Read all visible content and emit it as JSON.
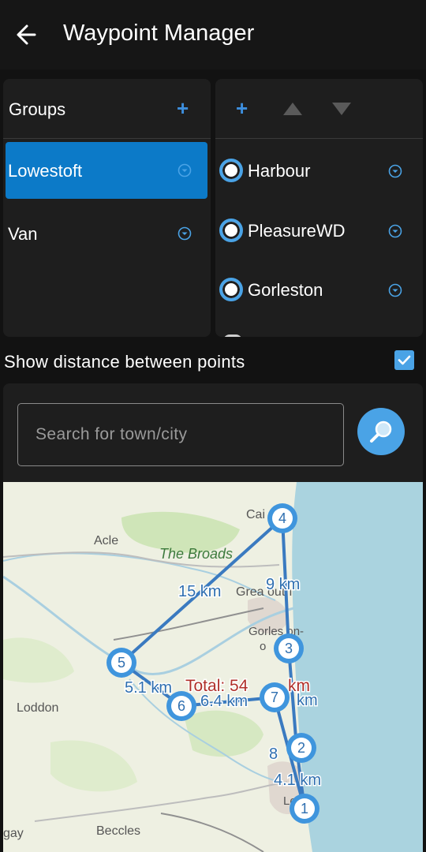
{
  "app": {
    "title": "Waypoint Manager"
  },
  "groups": {
    "header": "Groups",
    "add_label": "+",
    "items": [
      {
        "label": "Lowestoft",
        "selected": true
      },
      {
        "label": "Van",
        "selected": false
      }
    ]
  },
  "waypoints": {
    "add_label": "+",
    "items": [
      {
        "label": "Harbour"
      },
      {
        "label": "PleasureWD"
      },
      {
        "label": "Gorleston"
      }
    ]
  },
  "show_distance": {
    "label": "Show distance between points",
    "checked": true
  },
  "search": {
    "placeholder": "Search for town/city"
  },
  "map": {
    "place_names": {
      "caister": "Cai    n",
      "acle": "Acle",
      "broads": "The Broads",
      "great_yarmouth": "Grea         outh",
      "gorleston": "Gorles   on-",
      "gorleston_2": "o",
      "loddon": "Loddon",
      "lowestoft": "Lo      oft",
      "beccles": "Beccles",
      "bungay": "gay"
    },
    "distance_labels": {
      "d15": "15 km",
      "d9": "9 km",
      "d51": "5.1 km",
      "d64": "6.4 km",
      "total": "Total: 54",
      "total_suffix": "km",
      "km7": "km",
      "d8": "8",
      "d41": "4.1 km"
    },
    "markers": [
      "1",
      "2",
      "3",
      "4",
      "5",
      "6",
      "7"
    ],
    "colors": {
      "route": "#3a7ac0",
      "marker": "#3f95dd",
      "sea": "#aad3df",
      "land": "#eef0e2",
      "total": "#b0302a"
    }
  },
  "colors": {
    "accent": "#4aa3e6",
    "selected": "#0c7ac8",
    "background": "#121212",
    "panel": "#1e1e1e"
  }
}
